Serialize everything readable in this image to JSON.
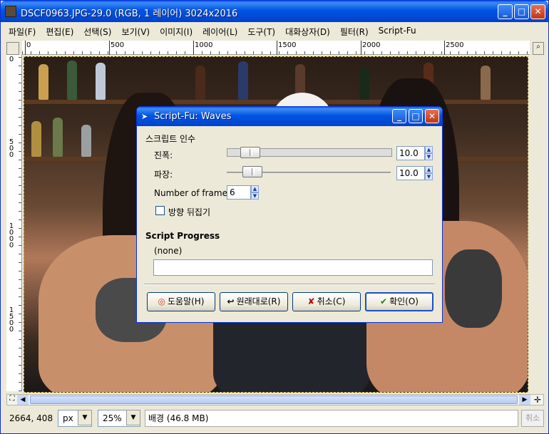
{
  "window": {
    "title": "DSCF0963.JPG-29.0 (RGB, 1 레이어) 3024x2016",
    "minimize": "_",
    "maximize": "□",
    "close": "✕"
  },
  "menu": [
    "파일(F)",
    "편집(E)",
    "선택(S)",
    "보기(V)",
    "이미지(I)",
    "레이어(L)",
    "도구(T)",
    "대화상자(D)",
    "필터(R)",
    "Script-Fu"
  ],
  "ruler": {
    "h_ticks": [
      "0",
      "500",
      "1000",
      "1500",
      "2000",
      "2500"
    ],
    "v_ticks": [
      "0",
      "500",
      "1000",
      "1500"
    ]
  },
  "status": {
    "coords": "2664, 408",
    "unit": "px",
    "zoom": "25%",
    "message": "배경  (46.8 MB)",
    "cancel": "취소"
  },
  "dialog": {
    "title": "Script-Fu: Waves",
    "section": "스크립트 인수",
    "amplitude_label": "진폭:",
    "amplitude_value": "10.0",
    "wavelength_label": "파장:",
    "wavelength_value": "10.0",
    "frames_label": "Number of frames:",
    "frames_value": "6",
    "reverse_label": "방향 뒤집기",
    "reverse_checked": false,
    "progress_label": "Script Progress",
    "progress_status": "(none)",
    "buttons": {
      "help": "도움말(H)",
      "reset": "원래대로(R)",
      "cancel": "취소(C)",
      "ok": "확인(O)"
    }
  }
}
